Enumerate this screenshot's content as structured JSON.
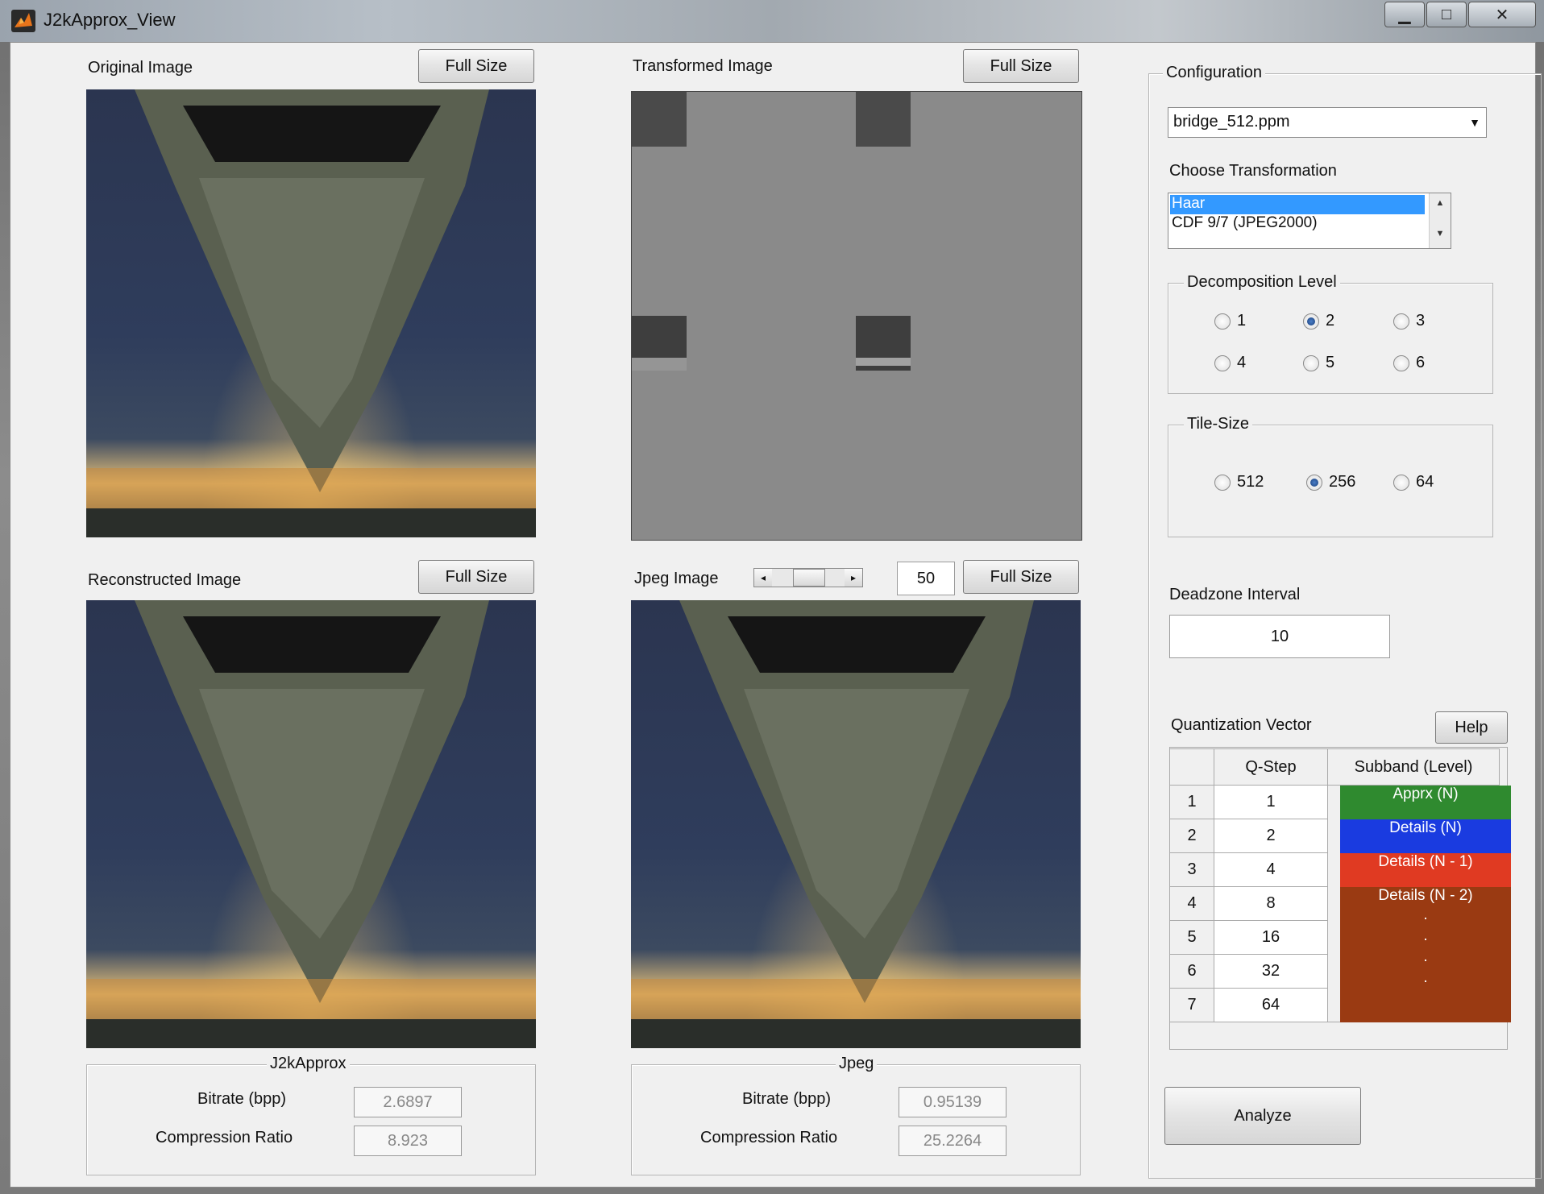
{
  "window": {
    "title": "J2kApprox_View"
  },
  "panels": {
    "original": {
      "title": "Original Image",
      "button": "Full Size"
    },
    "transformed": {
      "title": "Transformed Image",
      "button": "Full Size"
    },
    "reconstructed": {
      "title": "Reconstructed Image",
      "button": "Full Size"
    },
    "jpeg": {
      "title": "Jpeg Image",
      "quality": "50",
      "button": "Full Size",
      "slider_level": 0.5
    }
  },
  "stats": {
    "j2k": {
      "title": "J2kApprox",
      "bitrate_label": "Bitrate (bpp)",
      "bitrate_value": "2.6897",
      "ratio_label": "Compression Ratio",
      "ratio_value": "8.923"
    },
    "jpeg": {
      "title": "Jpeg",
      "bitrate_label": "Bitrate (bpp)",
      "bitrate_value": "0.95139",
      "ratio_label": "Compression Ratio",
      "ratio_value": "25.2264"
    }
  },
  "config": {
    "title": "Configuration",
    "file_select": "bridge_512.ppm",
    "transform_label": "Choose Transformation",
    "transforms": [
      {
        "label": "Haar",
        "selected": true
      },
      {
        "label": "CDF 9/7 (JPEG2000)",
        "selected": false
      }
    ],
    "decomposition": {
      "title": "Decomposition Level",
      "options": [
        "1",
        "2",
        "3",
        "4",
        "5",
        "6"
      ],
      "selected": "2"
    },
    "tile": {
      "title": "Tile-Size",
      "options": [
        "512",
        "256",
        "64"
      ],
      "selected": "256"
    },
    "deadzone": {
      "label": "Deadzone Interval",
      "value": "10"
    },
    "quant": {
      "label": "Quantization Vector",
      "help": "Help",
      "headers": [
        "Q-Step",
        "Subband (Level)"
      ],
      "rows": [
        {
          "n": "1",
          "q": "1"
        },
        {
          "n": "2",
          "q": "2"
        },
        {
          "n": "3",
          "q": "4"
        },
        {
          "n": "4",
          "q": "8"
        },
        {
          "n": "5",
          "q": "16"
        },
        {
          "n": "6",
          "q": "32"
        },
        {
          "n": "7",
          "q": "64"
        }
      ],
      "subbands": [
        {
          "label": "Apprx  (N)",
          "color": "#2f8a2f"
        },
        {
          "label": "Details (N)",
          "color": "#1a3be0"
        },
        {
          "label": "Details (N - 1)",
          "color": "#e03a22"
        },
        {
          "label": "Details (N - 2)",
          "color": "#9a3a12"
        }
      ],
      "dots": "."
    },
    "analyze": "Analyze"
  }
}
